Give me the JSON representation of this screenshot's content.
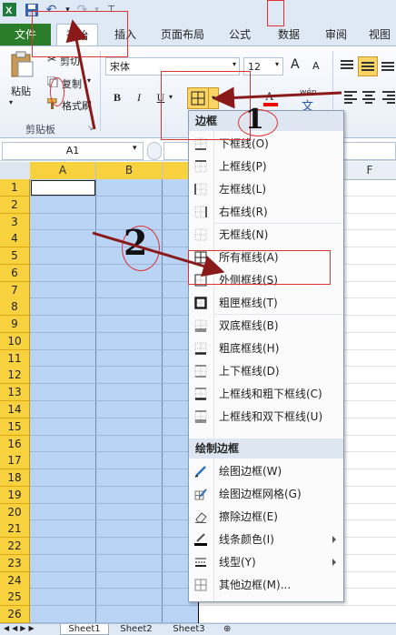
{
  "qat": {
    "undo": "↶",
    "redo": "↷"
  },
  "tabs": [
    {
      "label": "文件"
    },
    {
      "label": "开始"
    },
    {
      "label": "插入"
    },
    {
      "label": "页面布局"
    },
    {
      "label": "公式"
    },
    {
      "label": "数据"
    },
    {
      "label": "审阅"
    },
    {
      "label": "视图"
    }
  ],
  "clipboard": {
    "paste": "粘贴",
    "cut": "剪切",
    "copy": "复制",
    "format_painter": "格式刷",
    "group": "剪贴板"
  },
  "font": {
    "name": "宋体",
    "size": "12",
    "bold": "B",
    "italic": "I",
    "underline": "U",
    "grow": "A",
    "shrink": "A",
    "wen": "wén"
  },
  "formula": {
    "namebox": "A1"
  },
  "columns": [
    "A",
    "B",
    "F"
  ],
  "rows": [
    "1",
    "2",
    "3",
    "4",
    "5",
    "6",
    "7",
    "8",
    "9",
    "10",
    "11",
    "12",
    "13",
    "14",
    "15",
    "16",
    "17",
    "18",
    "19",
    "20",
    "21",
    "22",
    "23",
    "24",
    "25",
    "26"
  ],
  "sheets": [
    "Sheet1",
    "Sheet2",
    "Sheet3"
  ],
  "menu": {
    "header_border": "边框",
    "items1": [
      {
        "label": "下框线(O)",
        "icon": "bottom-border-icon"
      },
      {
        "label": "上框线(P)",
        "icon": "top-border-icon"
      },
      {
        "label": "左框线(L)",
        "icon": "left-border-icon"
      },
      {
        "label": "右框线(R)",
        "icon": "right-border-icon"
      },
      {
        "label": "无框线(N)",
        "icon": "no-border-icon"
      },
      {
        "label": "所有框线(A)",
        "icon": "all-borders-icon"
      },
      {
        "label": "外侧框线(S)",
        "icon": "outside-borders-icon"
      },
      {
        "label": "粗匣框线(T)",
        "icon": "thick-box-border-icon"
      },
      {
        "label": "双底框线(B)",
        "icon": "double-bottom-border-icon"
      },
      {
        "label": "粗底框线(H)",
        "icon": "thick-bottom-border-icon"
      },
      {
        "label": "上下框线(D)",
        "icon": "top-bottom-border-icon"
      },
      {
        "label": "上框线和粗下框线(C)",
        "icon": "top-thick-bottom-border-icon"
      },
      {
        "label": "上框线和双下框线(U)",
        "icon": "top-double-bottom-border-icon"
      }
    ],
    "header_draw": "绘制边框",
    "items2": [
      {
        "label": "绘图边框(W)",
        "icon": "draw-border-icon"
      },
      {
        "label": "绘图边框网格(G)",
        "icon": "draw-border-grid-icon"
      },
      {
        "label": "擦除边框(E)",
        "icon": "erase-border-icon"
      },
      {
        "label": "线条颜色(I)",
        "icon": "line-color-icon"
      },
      {
        "label": "线型(Y)",
        "icon": "line-style-icon"
      },
      {
        "label": "其他边框(M)...",
        "icon": "more-borders-icon"
      }
    ]
  },
  "annotations": {
    "num1": "1",
    "num2": "2"
  },
  "colors": {
    "file_tab": "#2b7d2b",
    "selection": "#b9d4f5",
    "row_header": "#f7d23e",
    "annot": "#d33",
    "arrow": "#8a1a1a"
  }
}
